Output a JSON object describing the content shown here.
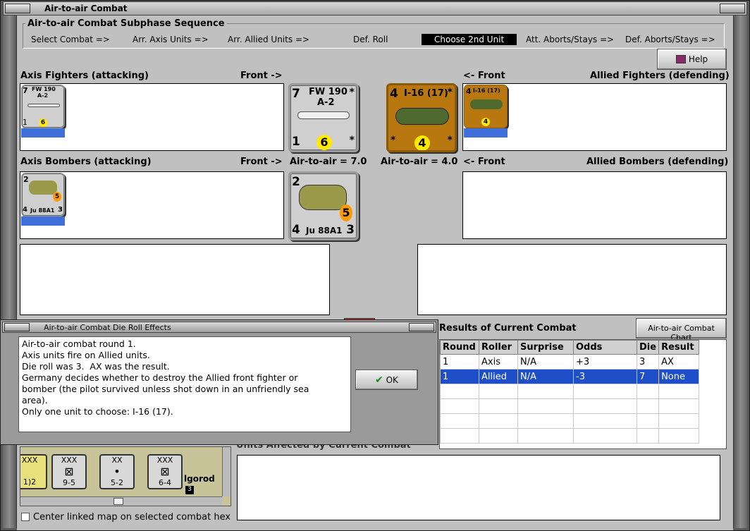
{
  "window": {
    "title": "Air-to-air Combat"
  },
  "sequence": {
    "title": "Air-to-air Combat Subphase Sequence",
    "steps": [
      "Select Combat =>",
      "Arr. Axis Units =>",
      "Arr. Allied Units  =>",
      "Def. Roll",
      "Choose 2nd Unit",
      "Att. Aborts/Stays =>",
      "Def. Aborts/Stays =>"
    ]
  },
  "help_label": "Help",
  "axis_fighters": {
    "label": "Axis Fighters (attacking)",
    "front": "Front ->"
  },
  "allied_fighters": {
    "label": "Allied Fighters (defending)",
    "front": "<- Front"
  },
  "axis_bombers": {
    "label": "Axis Bombers (attacking)",
    "front": "Front ->"
  },
  "allied_bombers": {
    "label": "Allied Bombers (defending)",
    "front": "<- Front"
  },
  "air_to_air_axis": "Air-to-air = 7.0",
  "air_to_air_allied": "Air-to-air = 4.0",
  "units": {
    "fw190": {
      "name1": "FW 190",
      "name2": "A-2",
      "air": "7",
      "range": "1",
      "move": "6",
      "star": "*"
    },
    "i16": {
      "name": "I-16 (17)",
      "air": "4",
      "move": "4",
      "star": "*"
    },
    "ju88": {
      "name": "Ju 88A1",
      "air": "2",
      "bomb": "4",
      "def": "3",
      "move": "5"
    }
  },
  "results": {
    "title": "Results of Current Combat",
    "chart_button": "Air-to-air Combat Chart",
    "columns": [
      "Round",
      "Roller",
      "Surprise",
      "Odds",
      "Die",
      "Result"
    ],
    "rows": [
      [
        "1",
        "Axis",
        "N/A",
        "+3",
        "3",
        "AX"
      ],
      [
        "1",
        "Allied",
        "N/A",
        "-3",
        "7",
        "None"
      ]
    ]
  },
  "dialog": {
    "title": "Air-to-air Combat Die Roll Effects",
    "message": "Air-to-air combat round 1.\nAxis units fire on Allied units.\nDie roll was 3.  AX was the result.\nGermany decides whether to destroy the Allied front fighter or\nbomber (the pilot survived unless shot down in an unfriendly sea\narea).\nOnly one unit to choose: I-16 (17).",
    "ok_label": "OK"
  },
  "units_affected_label": "Units Affected by Current Combat",
  "map": {
    "hexes": [
      {
        "top": "XXX",
        "mid": "",
        "bot": "1)2"
      },
      {
        "top": "XXX",
        "mid": "⊠",
        "bot": "9-5"
      },
      {
        "top": "XX",
        "mid": "•",
        "bot": "5-2"
      },
      {
        "top": "XXX",
        "mid": "⊠",
        "bot": "6-4"
      }
    ],
    "city": "lgorod",
    "badge": "3"
  },
  "center_label": "Center linked map on selected combat hex"
}
